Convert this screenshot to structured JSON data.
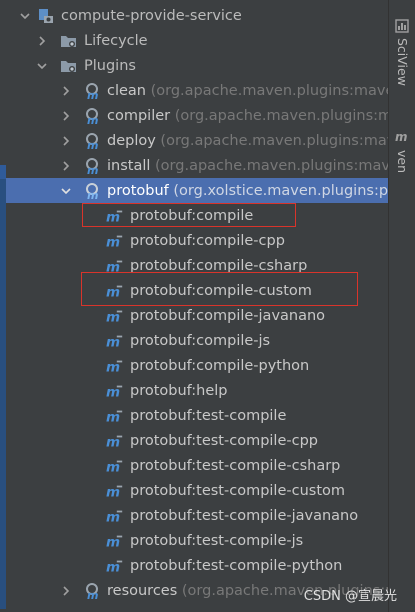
{
  "tree": {
    "root": "compute-provide-service",
    "lifecycle": "Lifecycle",
    "plugins": "Plugins",
    "plugin_items": [
      {
        "name": "clean",
        "meta": "(org.apache.maven.plugins:maven-cl"
      },
      {
        "name": "compiler",
        "meta": "(org.apache.maven.plugins:maven"
      },
      {
        "name": "deploy",
        "meta": "(org.apache.maven.plugins:maven-dep"
      },
      {
        "name": "install",
        "meta": "(org.apache.maven.plugins:maven-in"
      },
      {
        "name": "protobuf",
        "meta": "(org.xolstice.maven.plugins:proto"
      }
    ],
    "protobuf_goals": [
      "protobuf:compile",
      "protobuf:compile-cpp",
      "protobuf:compile-csharp",
      "protobuf:compile-custom",
      "protobuf:compile-javanano",
      "protobuf:compile-js",
      "protobuf:compile-python",
      "protobuf:help",
      "protobuf:test-compile",
      "protobuf:test-compile-cpp",
      "protobuf:test-compile-csharp",
      "protobuf:test-compile-custom",
      "protobuf:test-compile-javanano",
      "protobuf:test-compile-js",
      "protobuf:test-compile-python"
    ],
    "resources": {
      "name": "resources",
      "meta": "(org.apache.maven.plugins:maven-"
    }
  },
  "rightbar": {
    "tab1": "SciView",
    "tab2": "ven"
  },
  "watermark": "CSDN @宣晨光",
  "colors": {
    "background": "#3c3f41",
    "selection": "#4b6eaf",
    "highlight_box": "#d9342b",
    "maven_blue": "#4a8fd6"
  }
}
